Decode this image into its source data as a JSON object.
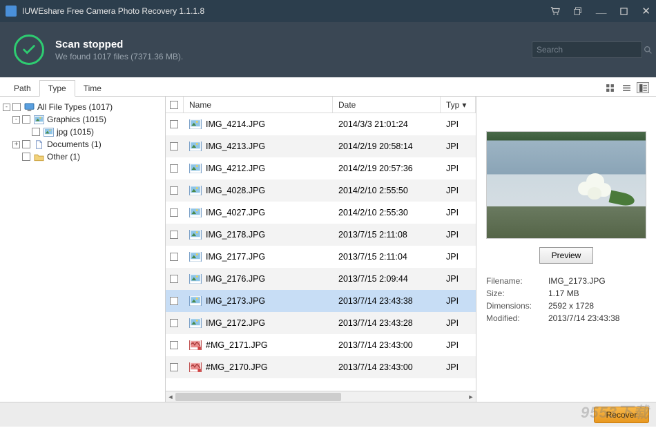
{
  "app": {
    "title": "IUWEshare Free Camera Photo Recovery 1.1.1.8"
  },
  "status": {
    "heading": "Scan stopped",
    "subtext": "We found 1017 files (7371.36 MB)."
  },
  "search": {
    "placeholder": "Search"
  },
  "tabs": {
    "path": "Path",
    "type": "Type",
    "time": "Time"
  },
  "tree": [
    {
      "indent": 0,
      "toggle": "-",
      "icon": "monitor",
      "label": "All File Types (1017)"
    },
    {
      "indent": 1,
      "toggle": "-",
      "icon": "pic",
      "label": "Graphics (1015)"
    },
    {
      "indent": 2,
      "toggle": "",
      "icon": "pic",
      "label": "jpg (1015)"
    },
    {
      "indent": 1,
      "toggle": "+",
      "icon": "doc",
      "label": "Documents (1)"
    },
    {
      "indent": 1,
      "toggle": "",
      "icon": "folder",
      "label": "Other (1)"
    }
  ],
  "columns": {
    "name": "Name",
    "date": "Date",
    "type": "Type"
  },
  "type_clip": "JPI",
  "rows": [
    {
      "name": "IMG_4214.JPG",
      "date": "2014/3/3 21:01:24",
      "icon": "pic"
    },
    {
      "name": "IMG_4213.JPG",
      "date": "2014/2/19 20:58:14",
      "icon": "pic"
    },
    {
      "name": "IMG_4212.JPG",
      "date": "2014/2/19 20:57:36",
      "icon": "pic"
    },
    {
      "name": "IMG_4028.JPG",
      "date": "2014/2/10 2:55:50",
      "icon": "pic"
    },
    {
      "name": "IMG_4027.JPG",
      "date": "2014/2/10 2:55:30",
      "icon": "pic"
    },
    {
      "name": "IMG_2178.JPG",
      "date": "2013/7/15 2:11:08",
      "icon": "pic"
    },
    {
      "name": "IMG_2177.JPG",
      "date": "2013/7/15 2:11:04",
      "icon": "pic"
    },
    {
      "name": "IMG_2176.JPG",
      "date": "2013/7/15 2:09:44",
      "icon": "pic"
    },
    {
      "name": "IMG_2173.JPG",
      "date": "2013/7/14 23:43:38",
      "icon": "pic",
      "selected": true
    },
    {
      "name": "IMG_2172.JPG",
      "date": "2013/7/14 23:43:28",
      "icon": "pic"
    },
    {
      "name": "#MG_2171.JPG",
      "date": "2013/7/14 23:43:00",
      "icon": "broken"
    },
    {
      "name": "#MG_2170.JPG",
      "date": "2013/7/14 23:43:00",
      "icon": "broken"
    }
  ],
  "preview": {
    "button": "Preview",
    "labels": {
      "filename": "Filename:",
      "size": "Size:",
      "dimensions": "Dimensions:",
      "modified": "Modified:"
    },
    "values": {
      "filename": "IMG_2173.JPG",
      "size": "1.17 MB",
      "dimensions": "2592 x 1728",
      "modified": "2013/7/14 23:43:38"
    }
  },
  "footer": {
    "recover": "Recover"
  },
  "watermark": "9553下载"
}
